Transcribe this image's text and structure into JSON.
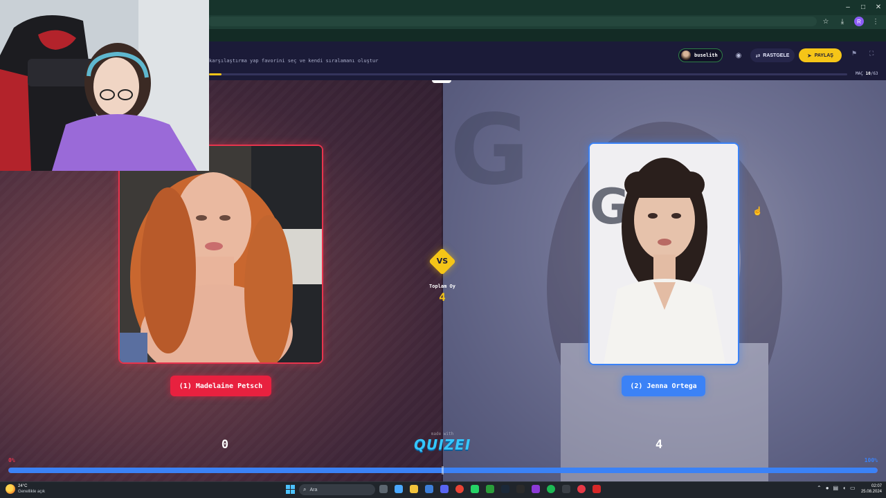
{
  "header": {
    "subtitle": "karşılaştırma yap favorini seç ve kendi sıralamanı oluştur",
    "user_name": "buselith",
    "random_label": "RASTGELE",
    "share_label": "PAYLAŞ",
    "match_label": "MAÇ",
    "match_current": "10",
    "match_total": "/63",
    "match_progress": 0.02
  },
  "arena": {
    "vs_label": "VS",
    "total_label": "Toplam Oy",
    "total_value": "4",
    "left": {
      "name": "(1) Madelaine Petsch",
      "score": "0",
      "percent": "0%"
    },
    "right": {
      "name": "(2) Jenna Ortega",
      "score": "4",
      "percent": "100%"
    },
    "vote_share_right": 1.0,
    "made_with": "made with",
    "brand": "QUIZEI"
  },
  "taskbar": {
    "weather_temp": "24°C",
    "weather_desc": "Genellikle açık",
    "search_label": "Ara",
    "time": "02:07",
    "date": "25.08.2024"
  },
  "icons": {
    "minimize": "minimize-icon",
    "maximize": "maximize-icon",
    "close": "close-icon",
    "star": "star-icon",
    "download": "download-icon",
    "eye": "eye-icon",
    "shuffle": "shuffle-icon",
    "send": "send-icon",
    "flag": "flag-icon",
    "fullscreen": "fullscreen-icon",
    "search": "search-icon"
  },
  "colors": {
    "accent_yellow": "#f5c518",
    "left_red": "#e8344d",
    "right_blue": "#3b82f6",
    "header_bg": "#1b1b38"
  }
}
